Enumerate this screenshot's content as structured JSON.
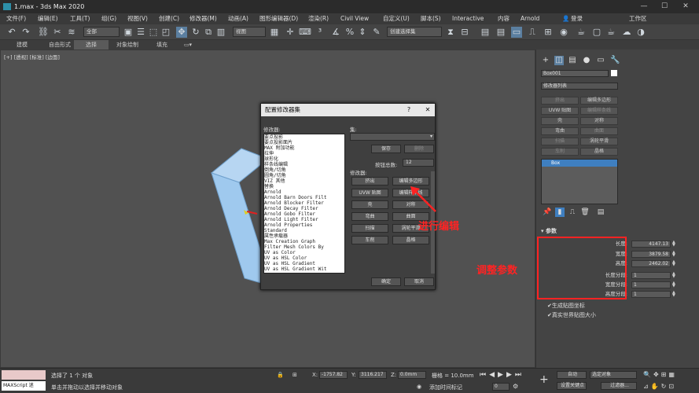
{
  "window": {
    "title": "1.max - 3ds Max 2020",
    "minimize": "—",
    "maximize": "☐",
    "close": "✕"
  },
  "menu": [
    "文件(F)",
    "编辑(E)",
    "工具(T)",
    "组(G)",
    "视图(V)",
    "创建(C)",
    "修改器(M)",
    "动画(A)",
    "图形编辑器(D)",
    "渲染(R)",
    "Civil View",
    "自定义(U)",
    "脚本(S)",
    "Interactive",
    "内容",
    "Arnold"
  ],
  "login": "登录",
  "workspace": "工作区",
  "toolbar": {
    "filter_dropdown": "全部",
    "view_dropdown": "视图",
    "selection_set": "创建选择集"
  },
  "ribbon_tabs": [
    "建模",
    "自由形式",
    "选择",
    "对象绘制",
    "填充"
  ],
  "viewport": {
    "label": "[+] [透视] [标准] [边面]"
  },
  "command_panel": {
    "object_name": "Box001",
    "modifier_list": "修改器列表",
    "modifier_buttons": [
      {
        "label": "挤出",
        "enabled": false
      },
      {
        "label": "编辑多边形",
        "enabled": true
      },
      {
        "label": "UVW 贴图",
        "enabled": true
      },
      {
        "label": "编辑样条线",
        "enabled": false
      },
      {
        "label": "壳",
        "enabled": true
      },
      {
        "label": "对称",
        "enabled": true
      },
      {
        "label": "弯曲",
        "enabled": true
      },
      {
        "label": "曲面",
        "enabled": false
      },
      {
        "label": "扫描",
        "enabled": false
      },
      {
        "label": "涡轮平滑",
        "enabled": true
      },
      {
        "label": "车削",
        "enabled": false
      },
      {
        "label": "晶格",
        "enabled": true
      }
    ],
    "stack_item": "Box",
    "rollout_title": "参数",
    "params": [
      {
        "label": "长度:",
        "value": "4147.13"
      },
      {
        "label": "宽度:",
        "value": "3879.58"
      },
      {
        "label": "高度:",
        "value": "2462.02"
      },
      {
        "label": "长度分段:",
        "value": "1"
      },
      {
        "label": "宽度分段:",
        "value": "1"
      },
      {
        "label": "高度分段:",
        "value": "1"
      }
    ],
    "checkboxes": [
      "生成贴图坐标",
      "真实世界贴图大小"
    ]
  },
  "dialog": {
    "title": "配置修改器集",
    "help": "?",
    "close": "✕",
    "modifiers_label": "修改器:",
    "sets_label": "集:",
    "save": "保存",
    "delete": "删除",
    "total_buttons_label": "按钮总数:",
    "total_buttons_value": "12",
    "modifiers_label2": "修改器:",
    "ok": "确定",
    "cancel": "取消",
    "list": [
      "要点投影",
      "要点投影面片",
      "MAX 附加功能",
      "拉伸",
      "球形化",
      "样条线编辑",
      "倒角/切角",
      "圆角/切角",
      "VIZ 其他",
      "替换",
      "Arnold",
      "  Arnold Barn Doors Filt",
      "  Arnold Blocker Filter",
      "  Arnold Decay Filter",
      "  Arnold Gobo Filter",
      "  Arnold Light Filter",
      "  Arnold Properties",
      "Standard",
      "  属性承载器",
      "Max Creation Graph",
      "  Filter Mesh Colors By",
      "  UV as Color",
      "  UV as HSL Color",
      "  UV as HSL Gradient",
      "  UV as HSL Gradient Wit"
    ],
    "buttons": [
      {
        "label": "挤出",
        "enabled": true
      },
      {
        "label": "编辑多边形",
        "enabled": true
      },
      {
        "label": "UVW 贴图",
        "enabled": true
      },
      {
        "label": "编辑样条线",
        "enabled": true
      },
      {
        "label": "壳",
        "enabled": true
      },
      {
        "label": "对称",
        "enabled": true
      },
      {
        "label": "弯曲",
        "enabled": true
      },
      {
        "label": "曲面",
        "enabled": true
      },
      {
        "label": "扫描",
        "enabled": true
      },
      {
        "label": "涡轮平滑",
        "enabled": true
      },
      {
        "label": "车削",
        "enabled": true
      },
      {
        "label": "晶格",
        "enabled": true
      }
    ]
  },
  "annotations": {
    "edit": "进行编辑",
    "adjust": "调整参数"
  },
  "status": {
    "maxscript": "MAXScript 迷",
    "selected": "选择了 1 个 对象",
    "hint": "单击并拖动以选择并移动对象",
    "x_label": "X:",
    "x_value": "-1757.82",
    "y_label": "Y:",
    "y_value": "3116.217",
    "z_label": "Z:",
    "z_value": "0.0mm",
    "grid": "栅格 = 10.0mm",
    "add_time_tag": "添加时间标记",
    "auto": "自动",
    "selected_object": "选定对象",
    "set_key": "设置关键点",
    "filters": "过滤器...",
    "frame": "0"
  },
  "colors": {
    "accent": "#2d8fa8",
    "annot": "#ff2323",
    "cube_face": "#9fc9ee"
  }
}
